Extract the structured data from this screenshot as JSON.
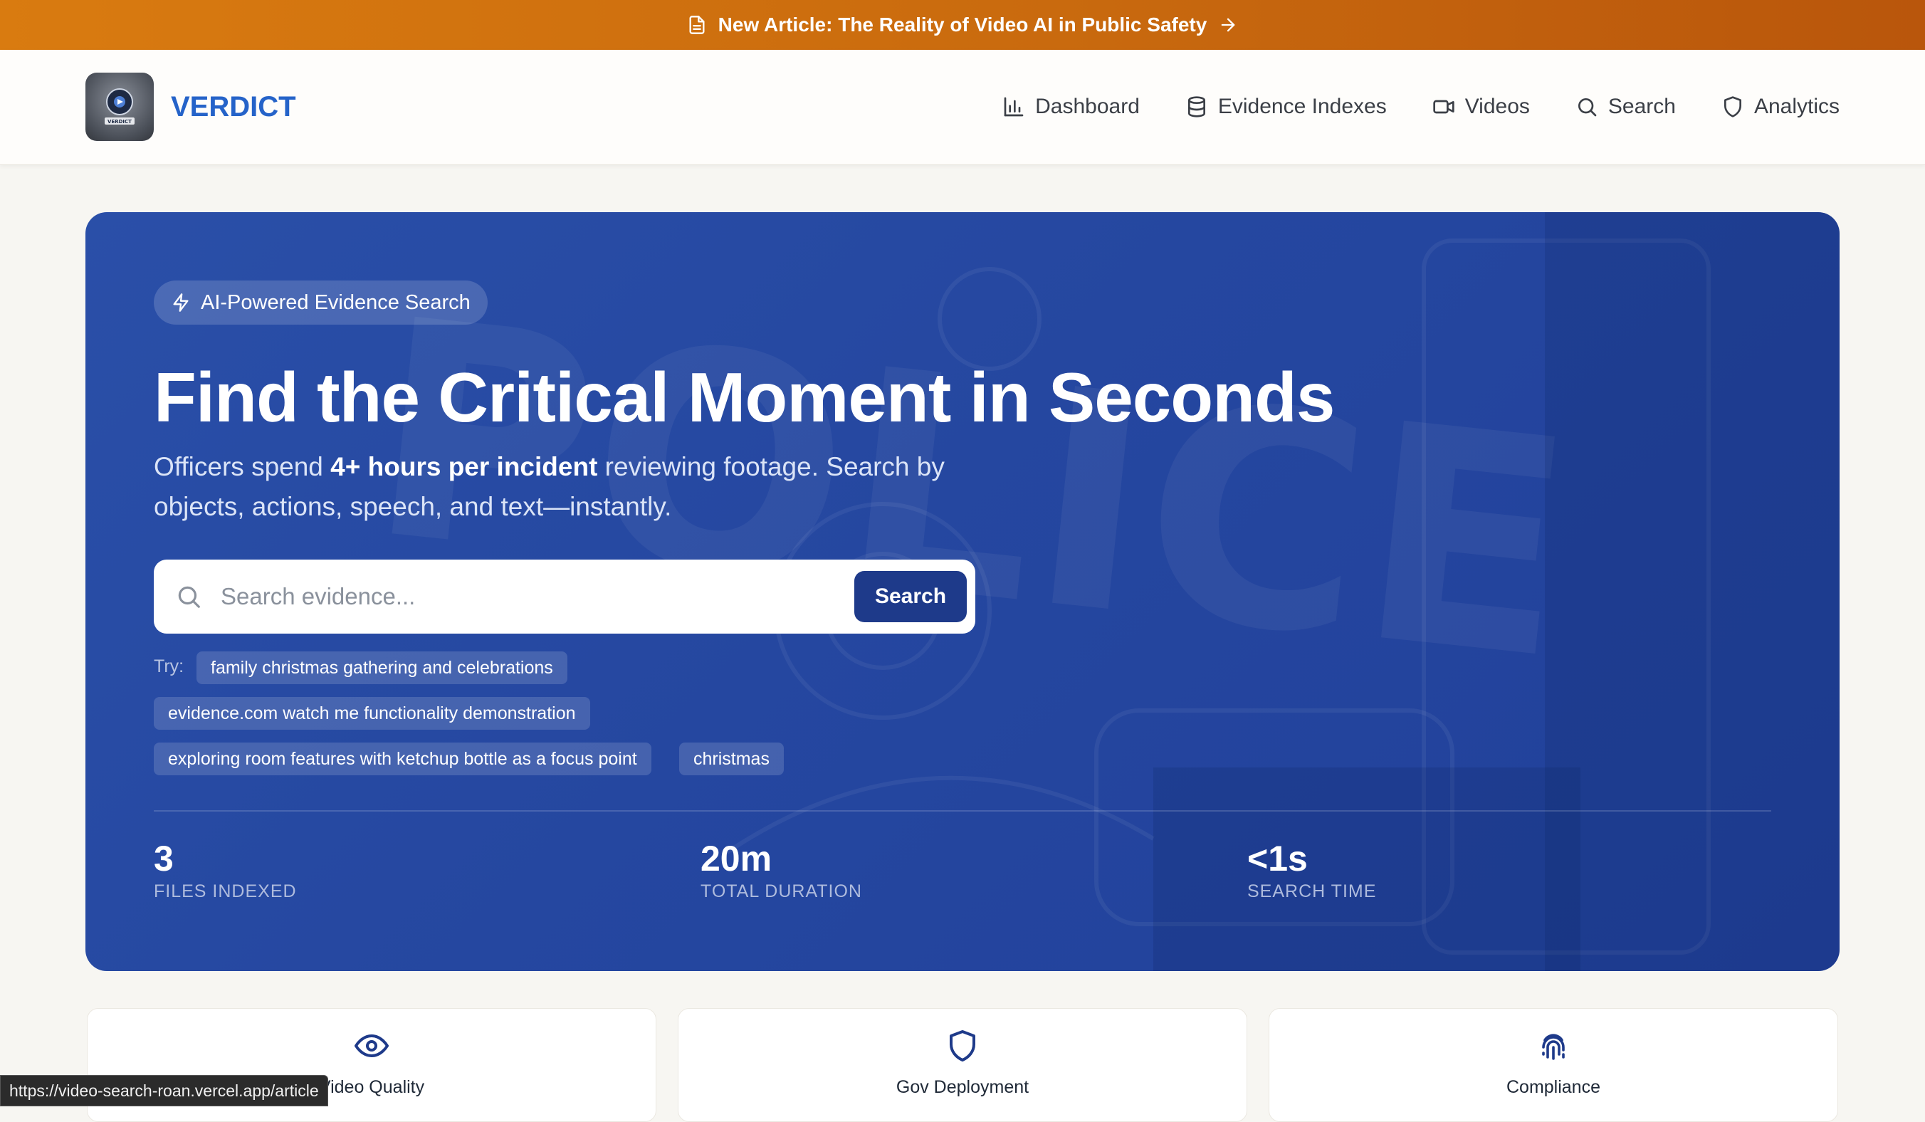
{
  "banner": {
    "text": "New Article: The Reality of Video AI in Public Safety"
  },
  "header": {
    "logo_text": "VERDICT",
    "brand": "VERDICT",
    "nav": [
      {
        "label": "Dashboard",
        "icon": "bar-chart-icon"
      },
      {
        "label": "Evidence Indexes",
        "icon": "database-icon"
      },
      {
        "label": "Videos",
        "icon": "video-icon"
      },
      {
        "label": "Search",
        "icon": "search-icon"
      },
      {
        "label": "Analytics",
        "icon": "shield-icon"
      }
    ]
  },
  "hero": {
    "pill": "AI-Powered Evidence Search",
    "title": "Find the Critical Moment in Seconds",
    "subtitle_pre": "Officers spend ",
    "subtitle_bold": "4+ hours per incident",
    "subtitle_post": " reviewing footage. Search by objects, actions, speech, and text—instantly.",
    "search": {
      "placeholder": "Search evidence...",
      "button": "Search"
    },
    "try_label": "Try:",
    "suggestions": [
      "family christmas gathering and celebrations",
      "evidence.com watch me functionality demonstration",
      "exploring room features with ketchup bottle as a focus point",
      "christmas"
    ],
    "stats": [
      {
        "value": "3",
        "label": "FILES INDEXED"
      },
      {
        "value": "20m",
        "label": "TOTAL DURATION"
      },
      {
        "value": "<1s",
        "label": "SEARCH TIME"
      }
    ]
  },
  "features": [
    {
      "label": "Video Quality",
      "icon": "eye-icon"
    },
    {
      "label": "Gov Deployment",
      "icon": "shield-icon"
    },
    {
      "label": "Compliance",
      "icon": "fingerprint-icon"
    }
  ],
  "status_url": "https://video-search-roan.vercel.app/article",
  "colors": {
    "banner": "#d97b10",
    "brand": "#2563c9",
    "hero": "#2547a0",
    "button": "#1e3a8a"
  }
}
